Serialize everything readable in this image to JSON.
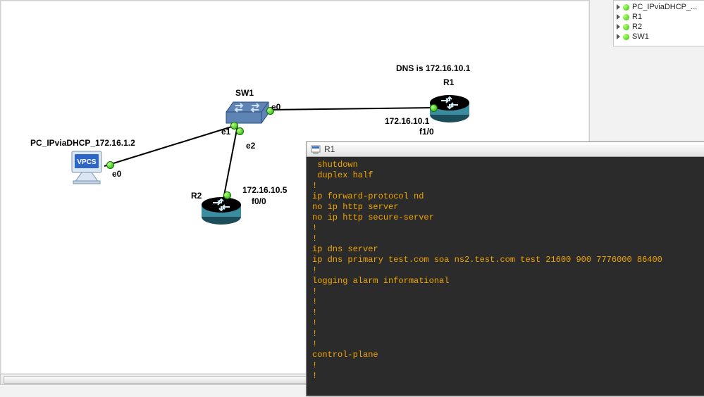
{
  "tree": {
    "items": [
      {
        "label": "PC_IPviaDHCP_..."
      },
      {
        "label": "R1"
      },
      {
        "label": "R2"
      },
      {
        "label": "SW1"
      }
    ]
  },
  "topology": {
    "dns_text": "DNS is 172.16.10.1",
    "sw1": {
      "name": "SW1",
      "ports": {
        "e0": "e0",
        "e1": "e1",
        "e2": "e2"
      }
    },
    "r1": {
      "name": "R1",
      "ip": "172.16.10.1",
      "port": "f1/0"
    },
    "r2": {
      "name": "R2",
      "ip": "172.16.10.5",
      "port": "f0/0"
    },
    "pc": {
      "name": "PC_IPviaDHCP_172.16.1.2",
      "badge": "VPCS",
      "port": "e0"
    }
  },
  "terminal": {
    "title": "R1",
    "lines": " shutdown\n duplex half\n!\nip forward-protocol nd\nno ip http server\nno ip http secure-server\n!\n!\nip dns server\nip dns primary test.com soa ns2.test.com test 21600 900 7776000 86400\n!\nlogging alarm informational\n!\n!\n!\n!\n!\n!\ncontrol-plane\n!\n!"
  }
}
